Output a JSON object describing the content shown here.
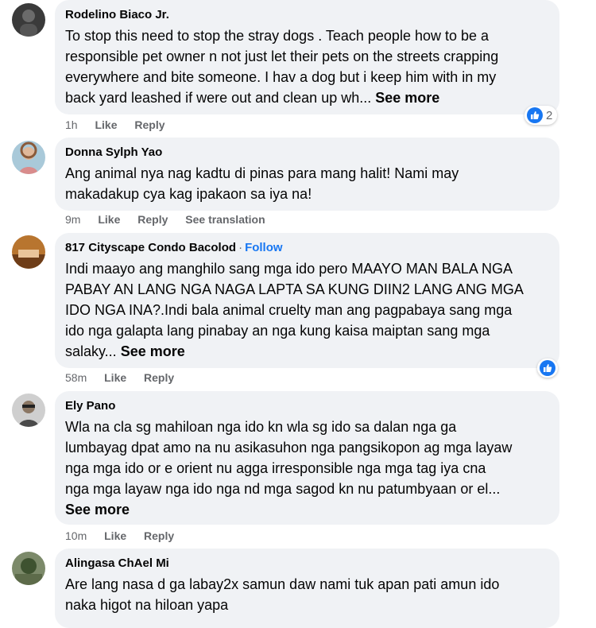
{
  "colors": {
    "bubble": "#f0f2f5",
    "link": "#1877f2",
    "meta": "#65676b",
    "text": "#050505"
  },
  "comments": [
    {
      "author": "Rodelino Biaco Jr.",
      "lines": [
        "To stop this need to stop the stray dogs . Teach people how to be a",
        "responsible pet owner n not just let their pets on the streets crapping",
        "everywhere and bite someone. I hav a dog but i keep him with in my",
        "back yard leashed if were out and clean up wh... "
      ],
      "see_more": "See more",
      "time": "1h",
      "like": "Like",
      "reply": "Reply",
      "reaction_count": "2",
      "avatar_icon": "profile-photo"
    },
    {
      "author": "Donna Sylph Yao",
      "lines": [
        "Ang animal nya nag kadtu di pinas para mang halit! Nami may",
        "makadakup cya kag ipakaon sa iya na!"
      ],
      "time": "9m",
      "like": "Like",
      "reply": "Reply",
      "translation": "See translation",
      "avatar_icon": "profile-photo"
    },
    {
      "author": "817 Cityscape Condo Bacolod",
      "dot": "·",
      "follow": "Follow",
      "lines": [
        "Indi maayo ang manghilo sang mga ido pero MAAYO MAN BALA NGA",
        "PABAY AN LANG NGA NAGA LAPTA SA KUNG DIIN2 LANG ANG MGA",
        "IDO NGA INA?.Indi bala animal cruelty man ang pagpabaya sang mga",
        "ido nga galapta lang pinabay an nga kung kaisa maiptan sang mga",
        "salaky... "
      ],
      "see_more": "See more",
      "time": "58m",
      "like": "Like",
      "reply": "Reply",
      "avatar_icon": "page-photo"
    },
    {
      "author": "Ely Pano",
      "lines": [
        "Wla na cla sg mahiloan nga ido kn wla sg ido sa dalan nga ga",
        "lumbayag dpat amo na nu asikasuhon nga pangsikopon ag mga layaw",
        "nga mga ido or e orient nu agga irresponsible nga mga tag iya cna",
        "nga mga layaw nga ido nga nd mga sagod kn nu patumbyaan or el..."
      ],
      "see_more": "See more",
      "time": "10m",
      "like": "Like",
      "reply": "Reply",
      "avatar_icon": "profile-photo"
    },
    {
      "author": "Alingasa ChAel Mi",
      "lines": [
        "Are lang nasa d ga labay2x samun daw nami tuk apan pati amun ido",
        "naka higot na hiloan yapa"
      ],
      "avatar_icon": "profile-photo"
    }
  ]
}
